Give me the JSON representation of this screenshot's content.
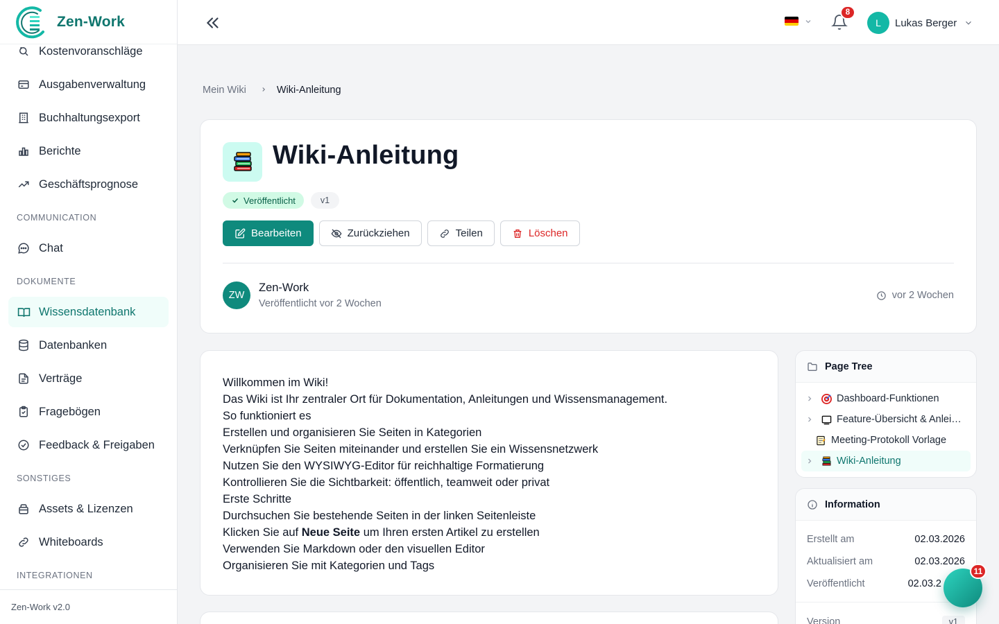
{
  "app": {
    "name": "Zen-Work",
    "version": "Zen-Work v2.0"
  },
  "sidebar": {
    "items_top": [
      {
        "label": "Kostenvoranschläge",
        "icon": "quote-icon"
      },
      {
        "label": "Ausgabenverwaltung",
        "icon": "credit-card-icon"
      },
      {
        "label": "Buchhaltungsexport",
        "icon": "building-icon"
      },
      {
        "label": "Berichte",
        "icon": "bar-chart-icon"
      },
      {
        "label": "Geschäftsprognose",
        "icon": "trend-icon"
      }
    ],
    "section_communication": "COMMUNICATION",
    "items_communication": [
      {
        "label": "Chat",
        "icon": "chat-icon"
      }
    ],
    "section_documents": "DOKUMENTE",
    "items_documents": [
      {
        "label": "Wissensdatenbank",
        "icon": "book-open-icon",
        "active": true
      },
      {
        "label": "Datenbanken",
        "icon": "database-icon"
      },
      {
        "label": "Verträge",
        "icon": "file-icon"
      },
      {
        "label": "Fragebögen",
        "icon": "clipboard-icon"
      },
      {
        "label": "Feedback & Freigaben",
        "icon": "check-circle-icon"
      }
    ],
    "section_misc": "SONSTIGES",
    "items_misc": [
      {
        "label": "Assets & Lizenzen",
        "icon": "box-icon"
      },
      {
        "label": "Whiteboards",
        "icon": "link-icon"
      }
    ],
    "section_integrations": "INTEGRATIONEN"
  },
  "topbar": {
    "notifications_count": "8",
    "user_initial": "L",
    "user_name": "Lukas Berger",
    "language_flag_colors": [
      "#000000",
      "#dd0000",
      "#ffce00"
    ]
  },
  "breadcrumb": {
    "parent": "Mein Wiki",
    "current": "Wiki-Anleitung"
  },
  "page": {
    "title": "Wiki-Anleitung",
    "status": "Veröffentlicht",
    "version": "v1",
    "actions": {
      "edit": "Bearbeiten",
      "withdraw": "Zurückziehen",
      "share": "Teilen",
      "delete": "Löschen"
    },
    "author": {
      "initials": "ZW",
      "name": "Zen-Work",
      "published": "Veröffentlicht vor 2 Wochen"
    },
    "updated": "vor 2 Wochen"
  },
  "content": {
    "lines": [
      "Willkommen im Wiki!",
      "Das Wiki ist Ihr zentraler Ort für Dokumentation, Anleitungen und Wissensmanagement.",
      "So funktioniert es",
      "Erstellen und organisieren Sie Seiten in Kategorien",
      "Verknüpfen Sie Seiten miteinander und erstellen Sie ein Wissensnetzwerk",
      "Nutzen Sie den WYSIWYG-Editor für reichhaltige Formatierung",
      "Kontrollieren Sie die Sichtbarkeit: öffentlich, teamweit oder privat",
      "Erste Schritte",
      "Durchsuchen Sie bestehende Seiten in der linken Seitenleiste"
    ],
    "line_click_prefix": "Klicken Sie auf ",
    "line_click_bold": "Neue Seite",
    "line_click_suffix": " um Ihren ersten Artikel zu erstellen",
    "lines_end": [
      "Verwenden Sie Markdown oder den visuellen Editor",
      "Organisieren Sie mit Kategorien und Tags"
    ]
  },
  "page_tree": {
    "title": "Page Tree",
    "items": [
      {
        "label": "Dashboard-Funktionen",
        "icon": "target-icon",
        "has_children": true
      },
      {
        "label": "Feature-Übersicht & Anlei…",
        "icon": "window-icon",
        "has_children": true
      },
      {
        "label": "Meeting-Protokoll Vorlage",
        "icon": "memo-icon",
        "has_children": false
      },
      {
        "label": "Wiki-Anleitung",
        "icon": "books-icon",
        "has_children": true,
        "active": true
      }
    ]
  },
  "information": {
    "title": "Information",
    "created_label": "Erstellt am",
    "created_value": "02.03.2026",
    "updated_label": "Aktualisiert am",
    "updated_value": "02.03.2026",
    "published_label": "Veröffentlicht",
    "published_value": "02.03.2",
    "version_label": "Version",
    "version_value": "v1"
  },
  "fab": {
    "badge": "11"
  },
  "colors": {
    "accent": "#0f8a7d",
    "danger": "#dc2626",
    "active_bg": "#f0fdfa"
  }
}
